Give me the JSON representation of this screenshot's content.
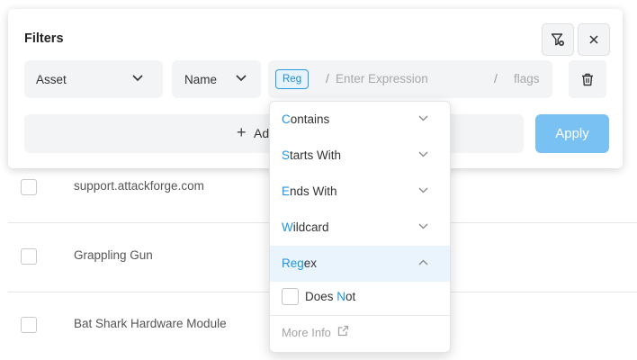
{
  "filters": {
    "title": "Filters",
    "asset_select": "Asset",
    "name_select": "Name",
    "regex_badge": "Reg",
    "slash": "/",
    "expression_placeholder": "Enter Expression",
    "flags_placeholder": "flags",
    "add_label": "Ad",
    "apply_label": "Apply"
  },
  "match_menu": {
    "items": [
      {
        "first": "C",
        "rest": "ontains",
        "icon": "chevron-down-icon"
      },
      {
        "first": "S",
        "rest": "tarts With",
        "icon": "chevron-down-icon"
      },
      {
        "first": "E",
        "rest": "nds With",
        "icon": "chevron-down-icon"
      },
      {
        "first": "W",
        "rest": "ildcard",
        "icon": "chevron-down-icon"
      },
      {
        "first": "Reg",
        "rest": "ex",
        "icon": "chevron-up-icon"
      }
    ],
    "does_not": {
      "before": "Does ",
      "accent": "N",
      "after": "ot"
    },
    "more_info": "More Info"
  },
  "table": {
    "rows": [
      {
        "name": "support.attackforge.com"
      },
      {
        "name": "Grappling Gun"
      },
      {
        "name": "Bat Shark Hardware Module"
      }
    ]
  },
  "colors": {
    "accent": "#1f95e2",
    "apply_bg": "#79c1f2",
    "field_bg": "#f3f4f6",
    "active_item_bg": "#e9f4fd"
  }
}
